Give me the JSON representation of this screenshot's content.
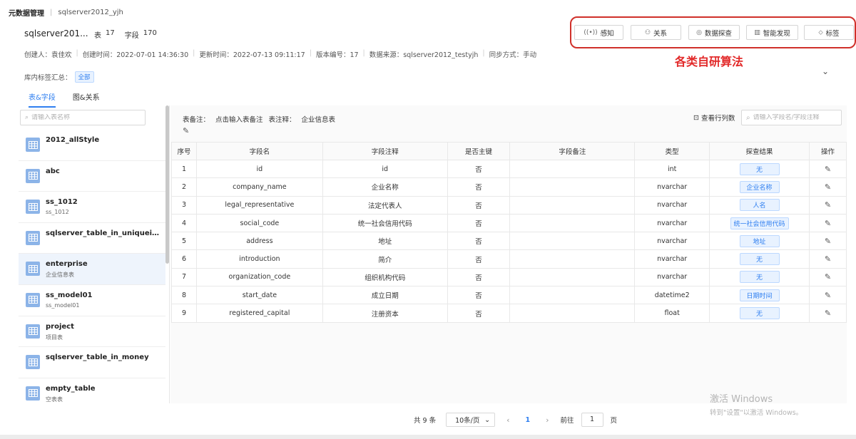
{
  "breadcrumb": {
    "root": "元数据管理",
    "current": "sqlserver2012_yjh"
  },
  "header": {
    "db_name": "sqlserver201...",
    "tables_label": "表",
    "tables_count": "17",
    "fields_label": "字段",
    "fields_count": "170"
  },
  "meta": [
    "创建人：袁佳欢",
    "创建时间：2022-07-01 14:36:30",
    "更新时间：2022-07-13 09:11:17",
    "版本编号：17",
    "数据来源：sqlserver2012_testyjh",
    "同步方式：手动"
  ],
  "tags": {
    "label": "库内标签汇总：",
    "all": "全部"
  },
  "toolbar": {
    "buttons": [
      {
        "label": "感知",
        "icon": "((•))"
      },
      {
        "label": "关系",
        "icon": "⚇"
      },
      {
        "label": "数据探查",
        "icon": "◎"
      },
      {
        "label": "智能发现",
        "icon": "▥"
      },
      {
        "label": "标签",
        "icon": "⬦"
      }
    ],
    "annotation": "各类自研算法"
  },
  "tabs": [
    {
      "label": "表&字段"
    },
    {
      "label": "图&关系"
    }
  ],
  "sidebar": {
    "search_placeholder": "请输入表名称",
    "tables": [
      {
        "name": "2012_allStyle",
        "desc": ""
      },
      {
        "name": "abc",
        "desc": ""
      },
      {
        "name": "ss_1012",
        "desc": "ss_1012"
      },
      {
        "name": "sqlserver_table_in_uniqueide...",
        "desc": ""
      },
      {
        "name": "enterprise",
        "desc": "企业信息表"
      },
      {
        "name": "ss_model01",
        "desc": "ss_model01"
      },
      {
        "name": "project",
        "desc": "项目表"
      },
      {
        "name": "sqlserver_table_in_money",
        "desc": ""
      },
      {
        "name": "empty_table",
        "desc": "空表表"
      }
    ]
  },
  "main": {
    "remark_label": "表备注：",
    "remark_value": "点击输入表备注",
    "comment_label": "表注释：",
    "comment_value": "企业信息表",
    "row_count": "查看行列数",
    "field_search_placeholder": "请输入字段名/字段注释",
    "columns": [
      "序号",
      "字段名",
      "字段注释",
      "是否主键",
      "字段备注",
      "类型",
      "探查结果",
      "操作"
    ],
    "rows": [
      {
        "no": "1",
        "name": "id",
        "comment": "id",
        "pk": "否",
        "remark": "",
        "type": "int",
        "result": "无"
      },
      {
        "no": "2",
        "name": "company_name",
        "comment": "企业名称",
        "pk": "否",
        "remark": "",
        "type": "nvarchar",
        "result": "企业名称"
      },
      {
        "no": "3",
        "name": "legal_representative",
        "comment": "法定代表人",
        "pk": "否",
        "remark": "",
        "type": "nvarchar",
        "result": "人名"
      },
      {
        "no": "4",
        "name": "social_code",
        "comment": "统一社会信用代码",
        "pk": "否",
        "remark": "",
        "type": "nvarchar",
        "result": "统一社会信用代码"
      },
      {
        "no": "5",
        "name": "address",
        "comment": "地址",
        "pk": "否",
        "remark": "",
        "type": "nvarchar",
        "result": "地址"
      },
      {
        "no": "6",
        "name": "introduction",
        "comment": "简介",
        "pk": "否",
        "remark": "",
        "type": "nvarchar",
        "result": "无"
      },
      {
        "no": "7",
        "name": "organization_code",
        "comment": "组织机构代码",
        "pk": "否",
        "remark": "",
        "type": "nvarchar",
        "result": "无"
      },
      {
        "no": "8",
        "name": "start_date",
        "comment": "成立日期",
        "pk": "否",
        "remark": "",
        "type": "datetime2",
        "result": "日期时间"
      },
      {
        "no": "9",
        "name": "registered_capital",
        "comment": "注册资本",
        "pk": "否",
        "remark": "",
        "type": "float",
        "result": "无"
      }
    ]
  },
  "pager": {
    "total": "共 9 条",
    "page_size": "10条/页",
    "current": "1",
    "goto_label": "前往",
    "goto_value": "1",
    "page_suffix": "页"
  },
  "watermark": {
    "line1": "激活 Windows",
    "line2": "转到\"设置\"以激活 Windows。"
  }
}
